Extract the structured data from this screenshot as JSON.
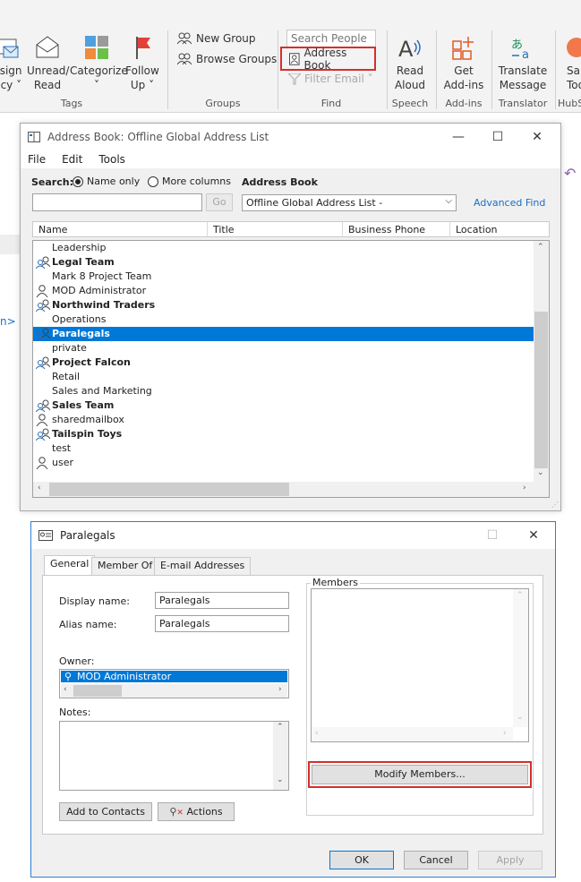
{
  "ribbon": {
    "tags_group": {
      "label": "Tags",
      "buttons": [
        {
          "label1": "ssign",
          "label2": "licy ˅"
        },
        {
          "label1": "Unread/",
          "label2": "Read"
        },
        {
          "label1": "Categorize",
          "label2": "˅"
        },
        {
          "label1": "Follow",
          "label2": "Up ˅"
        }
      ]
    },
    "groups_group": {
      "label": "Groups",
      "new_group": "New Group",
      "browse_groups": "Browse Groups"
    },
    "find_group": {
      "label": "Find",
      "search_placeholder": "Search People",
      "address_book": "Address Book",
      "filter_email": "Filter Email ˅"
    },
    "speech_group": {
      "label": "Speech",
      "read_aloud_1": "Read",
      "read_aloud_2": "Aloud"
    },
    "addins_group": {
      "label": "Add-ins",
      "get_1": "Get",
      "get_2": "Add-ins"
    },
    "translator_group": {
      "label": "Translator",
      "t1": "Translate",
      "t2": "Message"
    },
    "hub_group": {
      "label": "HubS",
      "h1": "Sal",
      "h2": "Too"
    }
  },
  "left_fragment": "n>",
  "address_book": {
    "title": "Address Book: Offline Global Address List",
    "menu": [
      "File",
      "Edit",
      "Tools"
    ],
    "search_label": "Search:",
    "radio_name_only": "Name only",
    "radio_more_columns": "More columns",
    "address_book_label": "Address Book",
    "search_value": "",
    "go_button": "Go",
    "book_select": "Offline Global Address List -",
    "advanced_find": "Advanced Find",
    "columns": [
      "Name",
      "Title",
      "Business Phone",
      "Location"
    ],
    "rows": [
      {
        "name": "Leadership",
        "icon": "none",
        "bold": false
      },
      {
        "name": "Legal Team",
        "icon": "group",
        "bold": true
      },
      {
        "name": "Mark 8 Project Team",
        "icon": "none",
        "bold": false
      },
      {
        "name": "MOD Administrator",
        "icon": "person",
        "bold": false
      },
      {
        "name": "Northwind Traders",
        "icon": "group",
        "bold": true
      },
      {
        "name": "Operations",
        "icon": "none",
        "bold": false
      },
      {
        "name": "Paralegals",
        "icon": "group",
        "bold": true,
        "selected": true
      },
      {
        "name": "private",
        "icon": "none",
        "bold": false
      },
      {
        "name": "Project Falcon",
        "icon": "group",
        "bold": true
      },
      {
        "name": "Retail",
        "icon": "none",
        "bold": false
      },
      {
        "name": "Sales and Marketing",
        "icon": "none",
        "bold": false
      },
      {
        "name": "Sales Team",
        "icon": "group",
        "bold": true
      },
      {
        "name": "sharedmailbox",
        "icon": "person",
        "bold": false
      },
      {
        "name": "Tailspin Toys",
        "icon": "group",
        "bold": true
      },
      {
        "name": "test",
        "icon": "none",
        "bold": false
      },
      {
        "name": "user",
        "icon": "person",
        "bold": false
      }
    ]
  },
  "paralegals": {
    "title": "Paralegals",
    "tabs": [
      "General",
      "Member Of",
      "E-mail Addresses"
    ],
    "display_name_label": "Display name:",
    "display_name": "Paralegals",
    "alias_label": "Alias name:",
    "alias": "Paralegals",
    "owner_label": "Owner:",
    "owner": "MOD Administrator",
    "notes_label": "Notes:",
    "notes": "",
    "members_label": "Members",
    "modify_members": "Modify Members...",
    "add_to_contacts": "Add to Contacts",
    "actions": "Actions",
    "ok": "OK",
    "cancel": "Cancel",
    "apply": "Apply"
  },
  "colors": {
    "accent": "#0078d7",
    "highlight_box": "#d42f2f",
    "link": "#1a6fc4"
  }
}
